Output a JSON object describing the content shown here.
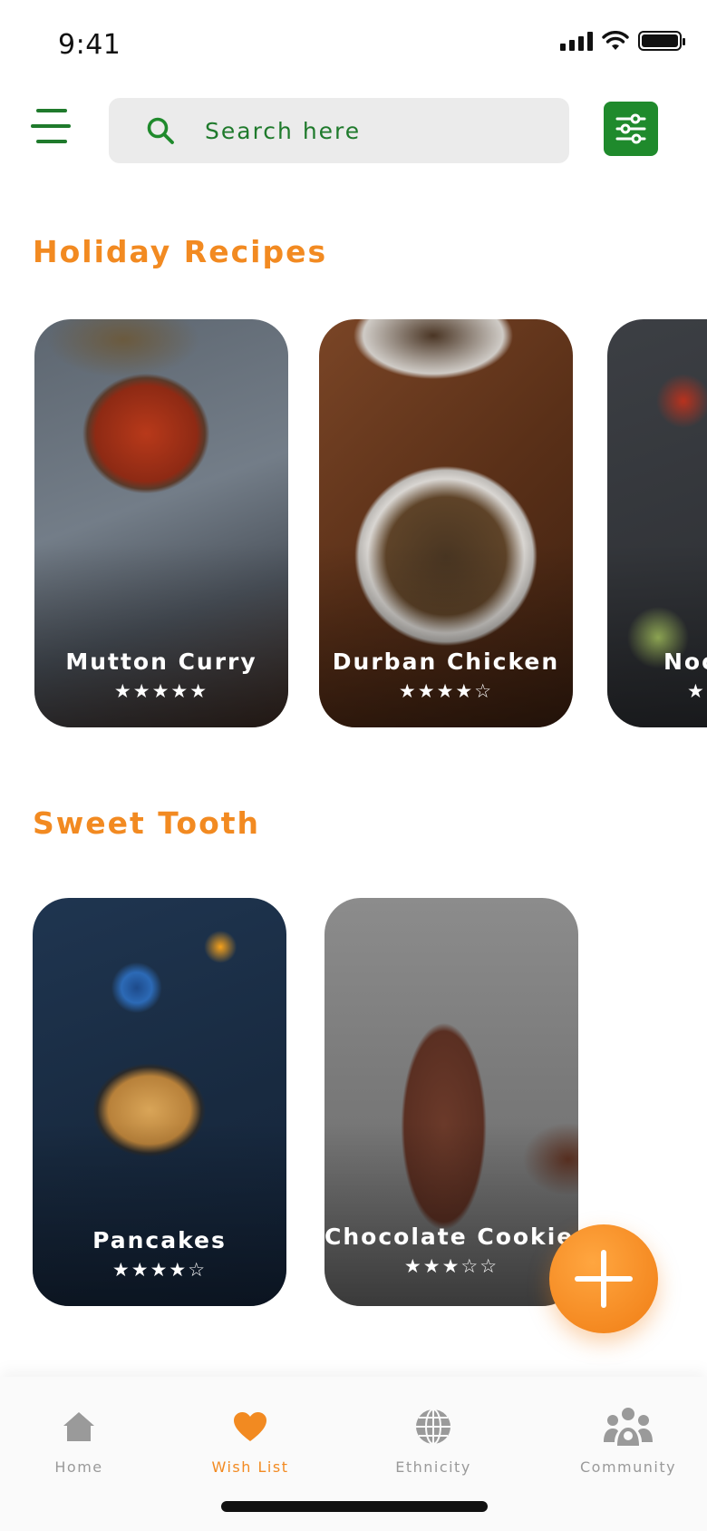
{
  "status_bar": {
    "time": "9:41"
  },
  "search": {
    "placeholder": "Search here"
  },
  "sections": [
    {
      "title": "Holiday Recipes",
      "cards": [
        {
          "title": "Mutton Curry",
          "stars": "★★★★★",
          "rating": 5
        },
        {
          "title": "Durban Chicken",
          "stars": "★★★★☆",
          "rating": 4
        },
        {
          "title": "Noodles",
          "stars": "★",
          "rating": 5
        }
      ]
    },
    {
      "title": "Sweet Tooth",
      "cards": [
        {
          "title": "Pancakes",
          "stars": "★★★★☆",
          "rating": 4
        },
        {
          "title": "Chocolate Cookies",
          "stars": "★★★☆☆",
          "rating": 3
        }
      ]
    }
  ],
  "fab": {
    "icon": "plus-icon"
  },
  "nav": {
    "items": [
      {
        "label": "Home",
        "icon": "home-icon"
      },
      {
        "label": "Wish List",
        "icon": "heart-icon",
        "active": true
      },
      {
        "label": "Ethnicity",
        "icon": "globe-icon"
      },
      {
        "label": "Community",
        "icon": "community-icon"
      }
    ]
  },
  "colors": {
    "accent_orange": "#f28a21",
    "brand_green": "#1f8a2c",
    "search_bg": "#ebebeb",
    "inactive_gray": "#9a9a9a"
  }
}
